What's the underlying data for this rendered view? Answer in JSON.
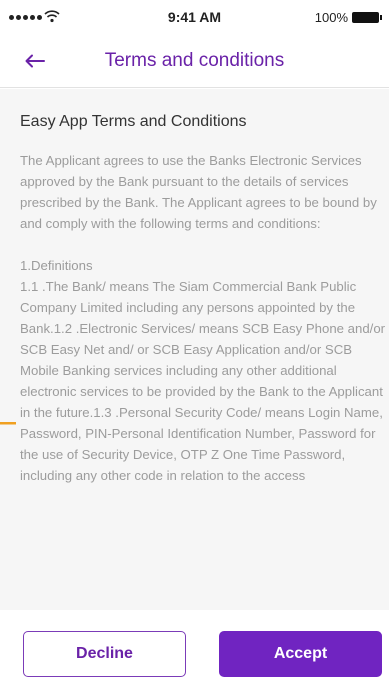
{
  "status_bar": {
    "time": "9:41 AM",
    "battery": "100%"
  },
  "nav": {
    "title": "Terms and conditions",
    "back_icon": "arrow-left-icon"
  },
  "document": {
    "title": "Easy App Terms and Conditions",
    "paragraph_1": "The Applicant agrees to use the Banks Electronic Services approved by the Bank pursuant to the details of services prescribed by the Bank. The Applicant agrees to be bound by and comply with the following terms and conditions:",
    "section_heading": "1.Definitions",
    "section_body": "1.1 .The Bank/ means The Siam Commercial Bank Public Company Limited including any persons appointed by the Bank.1.2 .Electronic Services/ means SCB Easy Phone and/or SCB Easy Net and/ or SCB Easy Application and/or SCB Mobile Banking services including any other additional electronic services to be provided by the Bank to the Applicant in the future.1.3 .Personal Security Code/ means Login Name, Password, PIN-Personal Identification Number, Password for the use of Security Device, OTP Z One Time Password, including any other code in relation to the access"
  },
  "actions": {
    "decline_label": "Decline",
    "accept_label": "Accept"
  },
  "colors": {
    "accent": "#7024c1",
    "title_purple": "#6a22a8",
    "marker_orange": "#f0a020"
  }
}
